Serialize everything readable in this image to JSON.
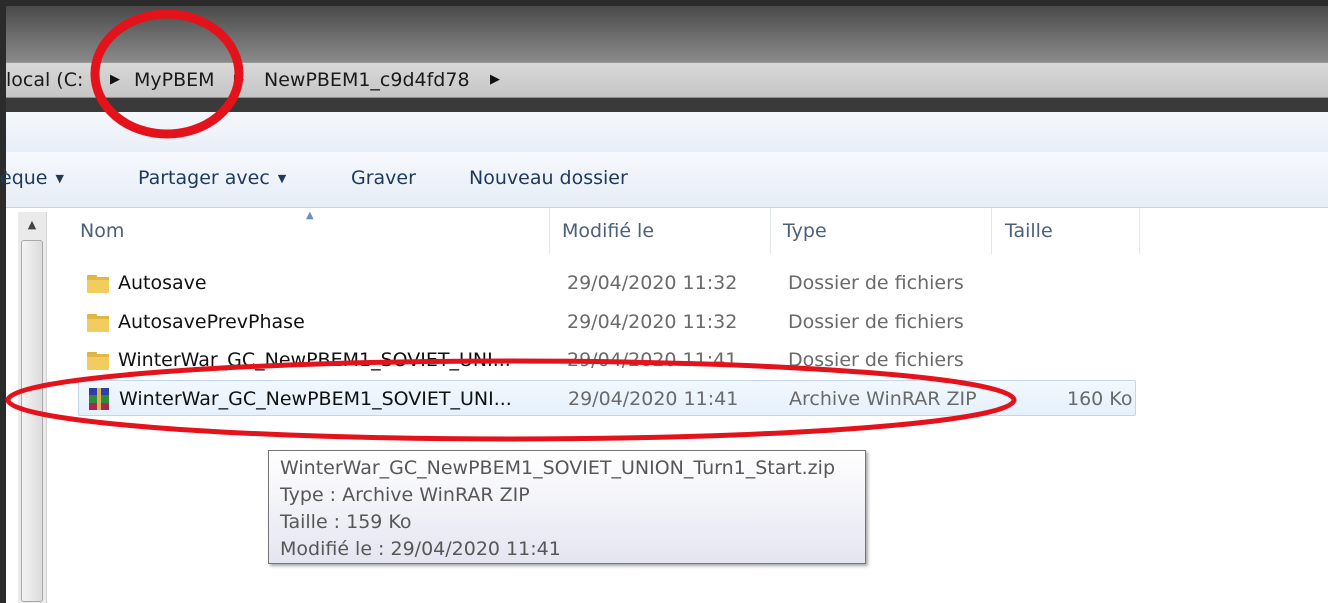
{
  "breadcrumb": {
    "items": [
      "local (C:",
      "MyPBEM",
      "NewPBEM1_c9d4fd78"
    ]
  },
  "toolbar": {
    "library_label": "èque",
    "share_label": "Partager avec",
    "burn_label": "Graver",
    "new_folder_label": "Nouveau dossier"
  },
  "columns": {
    "name": "Nom",
    "modified": "Modifié le",
    "type": "Type",
    "size": "Taille"
  },
  "files": [
    {
      "name": "Autosave",
      "modified": "29/04/2020 11:32",
      "type": "Dossier de fichiers",
      "size": "",
      "icon": "folder-icon"
    },
    {
      "name": "AutosavePrevPhase",
      "modified": "29/04/2020 11:32",
      "type": "Dossier de fichiers",
      "size": "",
      "icon": "folder-icon"
    },
    {
      "name": "WinterWar_GC_NewPBEM1_SOVIET_UNI...",
      "modified": "29/04/2020 11:41",
      "type": "Dossier de fichiers",
      "size": "",
      "icon": "folder-icon"
    },
    {
      "name": "WinterWar_GC_NewPBEM1_SOVIET_UNI...",
      "modified": "29/04/2020 11:41",
      "type": "Archive WinRAR ZIP",
      "size": "160 Ko",
      "icon": "winrar-icon"
    }
  ],
  "tooltip": {
    "filename": "WinterWar_GC_NewPBEM1_SOVIET_UNION_Turn1_Start.zip",
    "type_line": "Type : Archive WinRAR ZIP",
    "size_line": "Taille : 159 Ko",
    "modified_line": "Modifié le : 29/04/2020 11:41"
  },
  "colors": {
    "highlight_red": "#e3121b",
    "toolbar_text": "#1e395b",
    "selection_border": "#c3d6ec"
  }
}
